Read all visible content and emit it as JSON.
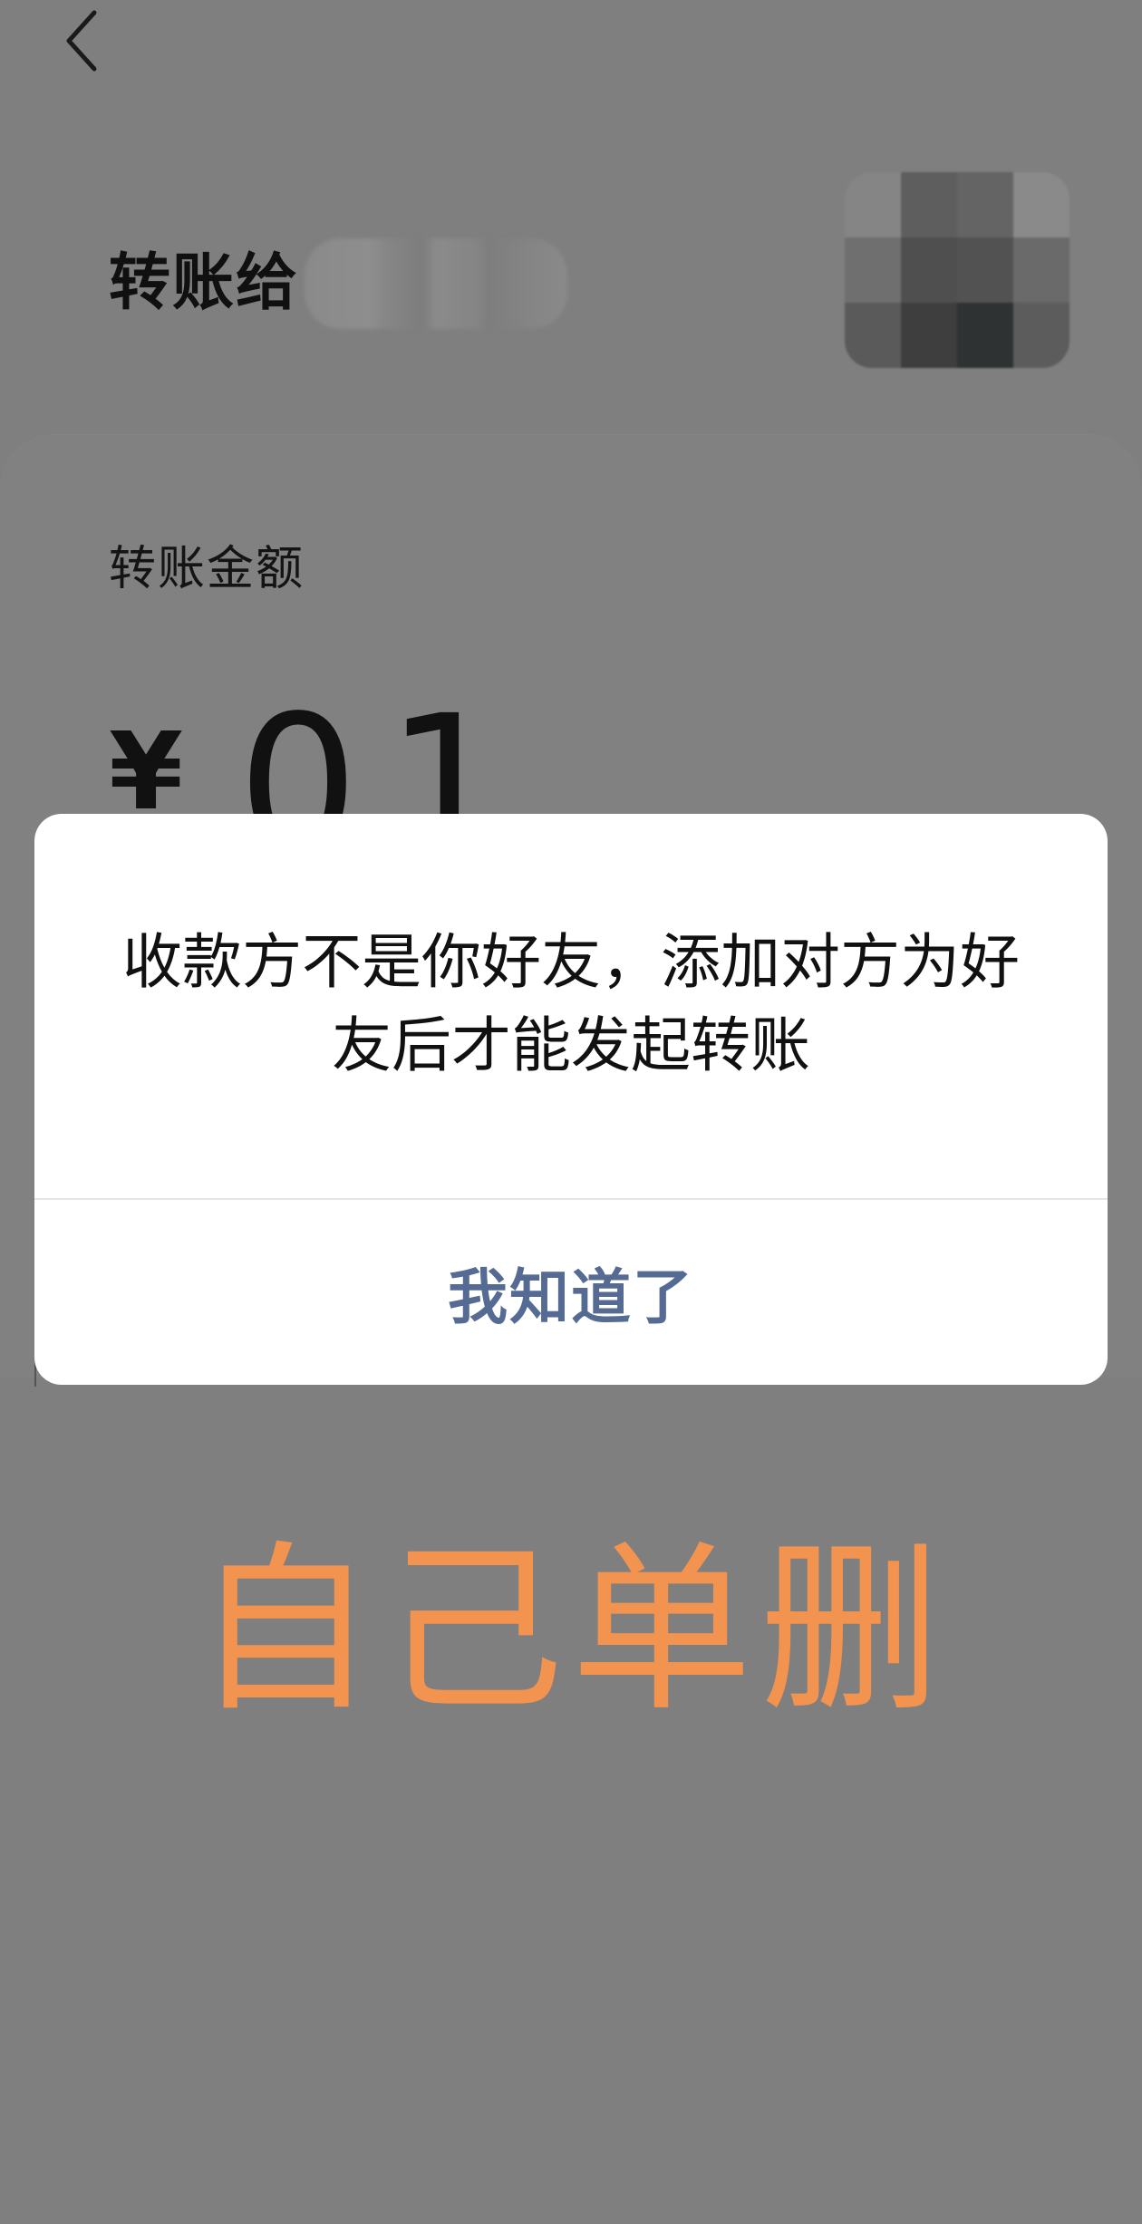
{
  "header": {
    "back_icon": "chevron-left-icon",
    "recipient_label": "转账给"
  },
  "transfer": {
    "amount_title": "转账金额",
    "currency_symbol": "¥",
    "amount": "01"
  },
  "dialog": {
    "message": "收款方不是你好友，添加对方为好友后才能发起转账",
    "confirm_label": "我知道了"
  },
  "overlay": {
    "caption": "自己单删"
  },
  "colors": {
    "backdrop": "#7f7f7f",
    "dialog_bg": "#ffffff",
    "confirm_text": "#566b94",
    "caption": "#f2934f"
  }
}
